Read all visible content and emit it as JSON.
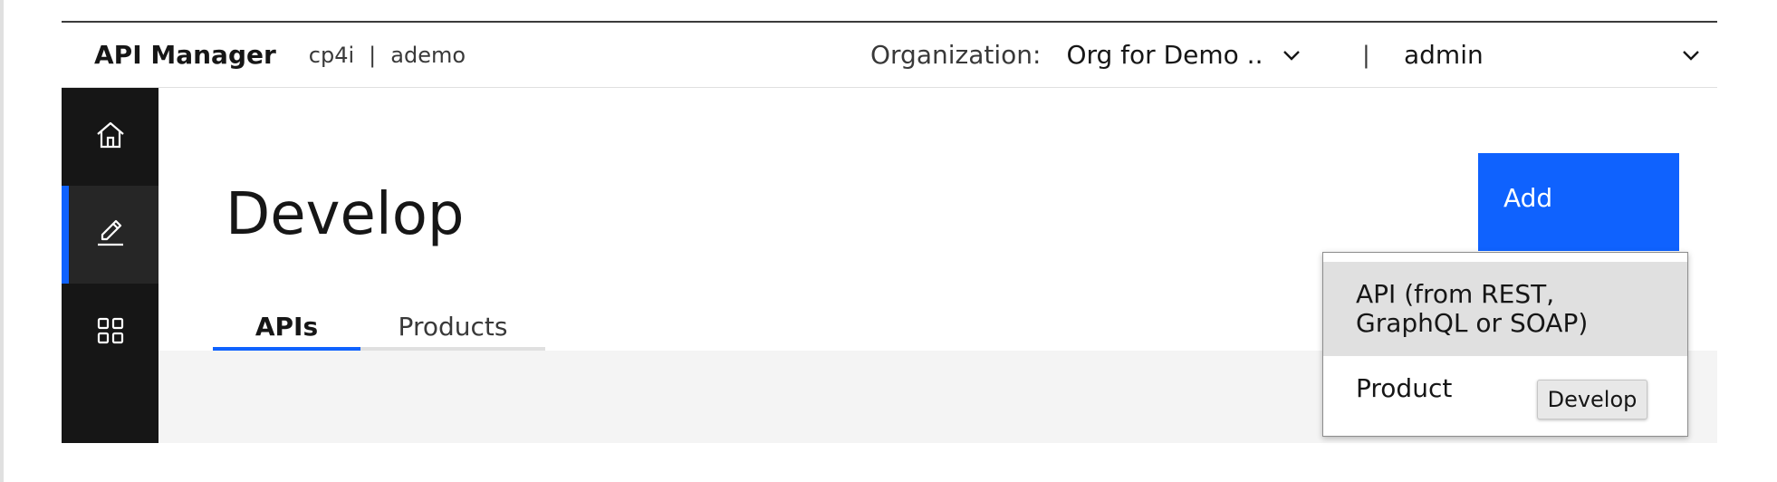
{
  "header": {
    "title": "API Manager",
    "context_primary": "cp4i",
    "context_separator": "|",
    "context_secondary": "ademo",
    "org_label": "Organization:",
    "org_value": "Org for Demo ...",
    "divider": "|",
    "user": "admin"
  },
  "rail": {
    "items": [
      {
        "icon": "home-icon"
      },
      {
        "icon": "edit-icon",
        "active": true
      },
      {
        "icon": "grid-icon"
      }
    ]
  },
  "main": {
    "page_title": "Develop",
    "add_label": "Add",
    "tabs": [
      {
        "label": "APIs",
        "active": true
      },
      {
        "label": "Products",
        "active": false
      }
    ]
  },
  "menu": {
    "items": [
      {
        "line1": "API (from REST,",
        "line2": "GraphQL or SOAP)"
      },
      {
        "label": "Product"
      }
    ]
  },
  "tooltip": {
    "text": "Develop"
  },
  "colors": {
    "accent": "#0f62fe",
    "rail_bg": "#161616",
    "rail_active_bg": "#262626",
    "content_bg": "#f4f4f4",
    "menu_highlight": "#e0e0e0"
  }
}
